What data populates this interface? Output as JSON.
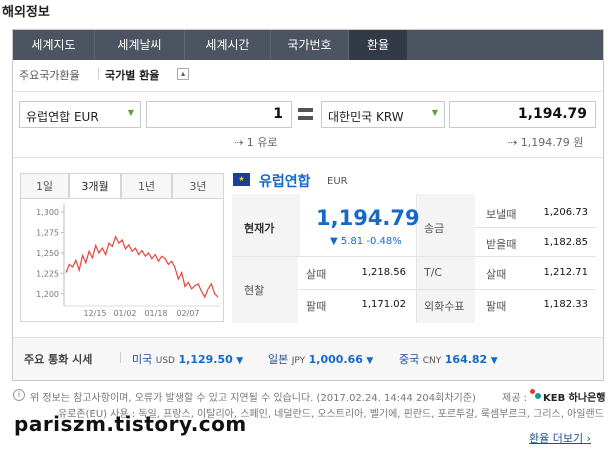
{
  "page_title": "해외정보",
  "nav_tabs": [
    "세계지도",
    "세계날씨",
    "세계시간",
    "국가번호",
    "환율"
  ],
  "subtabs": {
    "main": "주요국가환율",
    "active": "국가별 환율",
    "toggle_icon": "▴"
  },
  "converter": {
    "from_currency": "유럽연합 EUR",
    "from_amount": "1",
    "to_currency": "대한민국 KRW",
    "to_amount": "1,194.79",
    "from_hint": "1 유로",
    "to_hint": "1,194.79 원",
    "arrow_icon": "⇢"
  },
  "periods": [
    "1일",
    "3개월",
    "1년",
    "3년"
  ],
  "chart_data": {
    "type": "line",
    "y_ticks": [
      "1,300",
      "1,275",
      "1,250",
      "1,225",
      "1,200"
    ],
    "x_ticks": [
      "12/15",
      "01/02",
      "01/18",
      "02/07"
    ],
    "ylim": [
      1190,
      1305
    ],
    "values": [
      1226,
      1236,
      1233,
      1241,
      1229,
      1247,
      1238,
      1252,
      1244,
      1259,
      1250,
      1256,
      1248,
      1262,
      1258,
      1270,
      1262,
      1266,
      1255,
      1260,
      1252,
      1256,
      1248,
      1253,
      1246,
      1250,
      1243,
      1248,
      1240,
      1246,
      1243,
      1236,
      1240,
      1232,
      1218,
      1226,
      1209,
      1214,
      1206,
      1210,
      1212,
      1203,
      1196,
      1206,
      1212,
      1200,
      1196
    ],
    "line_color": "#e8423c"
  },
  "currency": {
    "flag_icon": "eu-flag-icon",
    "name": "유럽연합",
    "code": "EUR"
  },
  "rate": {
    "label": "현재가",
    "value": "1,194.79",
    "change_icon": "▼",
    "change": "5.81",
    "change_pct": "-0.48%"
  },
  "remit": {
    "label": "송금",
    "send_label": "보낼때",
    "send_value": "1,206.73",
    "recv_label": "받을때",
    "recv_value": "1,182.85"
  },
  "cash": {
    "label": "현찰",
    "buy_label": "살때",
    "buy_value": "1,218.56",
    "sell_label": "팔때",
    "sell_value": "1,171.02"
  },
  "tc": {
    "label": "T/C",
    "buy_label": "살때",
    "buy_value": "1,212.71"
  },
  "check": {
    "label": "외화수표",
    "sell_label": "팔때",
    "sell_value": "1,182.33"
  },
  "major": {
    "label": "주요 통화 시세",
    "items": [
      {
        "country": "미국",
        "code": "USD",
        "value": "1,129.50",
        "dir": "▼"
      },
      {
        "country": "일본",
        "code": "JPY",
        "value": "1,000.66",
        "dir": "▼"
      },
      {
        "country": "중국",
        "code": "CNY",
        "value": "164.82",
        "dir": "▼"
      }
    ]
  },
  "note": {
    "text": "위 정보는 참고사항이며, 오류가 발생할 수 있고 지연될 수 있습니다. (2017.02.24. 14:44 204회차기준)",
    "provider_label": "제공 :",
    "provider": "KEB 하나은행",
    "line2": "유로존(EU) 사용 : 독일, 프랑스, 이탈리아, 스페인, 네덜란드, 오스트리아, 벨기에, 핀란드, 포르투갈, 룩셈부르크, 그리스, 아일랜드"
  },
  "watermark": "pariszm.tistory.com",
  "more_link": "환율 더보기",
  "more_icon": "›"
}
